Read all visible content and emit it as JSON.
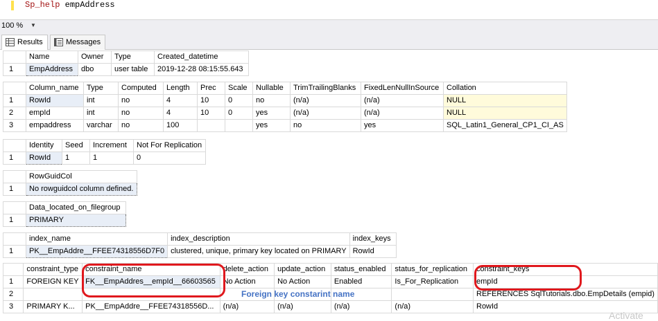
{
  "editor": {
    "keyword": "Sp_help",
    "object": "empAddress"
  },
  "zoom": {
    "value": "100 %"
  },
  "tabs": [
    {
      "label": "Results",
      "icon": "grid-icon"
    },
    {
      "label": "Messages",
      "icon": "messages-icon"
    }
  ],
  "grid1": {
    "headers": [
      "Name",
      "Owner",
      "Type",
      "Created_datetime"
    ],
    "rows": [
      {
        "n": "1",
        "cells": [
          "EmpAddress",
          "dbo",
          "user table",
          "2019-12-28 08:15:55.643"
        ]
      }
    ]
  },
  "grid2": {
    "headers": [
      "Column_name",
      "Type",
      "Computed",
      "Length",
      "Prec",
      "Scale",
      "Nullable",
      "TrimTrailingBlanks",
      "FixedLenNullInSource",
      "Collation"
    ],
    "rows": [
      {
        "n": "1",
        "cells": [
          "RowId",
          "int",
          "no",
          "4",
          "10",
          "0",
          "no",
          "(n/a)",
          "(n/a)",
          "NULL"
        ]
      },
      {
        "n": "2",
        "cells": [
          "empId",
          "int",
          "no",
          "4",
          "10",
          "0",
          "yes",
          "(n/a)",
          "(n/a)",
          "NULL"
        ]
      },
      {
        "n": "3",
        "cells": [
          "empaddress",
          "varchar",
          "no",
          "100",
          "",
          "",
          "yes",
          "no",
          "yes",
          "SQL_Latin1_General_CP1_CI_AS"
        ]
      }
    ]
  },
  "grid3": {
    "headers": [
      "Identity",
      "Seed",
      "Increment",
      "Not For Replication"
    ],
    "rows": [
      {
        "n": "1",
        "cells": [
          "RowId",
          "1",
          "1",
          "0"
        ]
      }
    ]
  },
  "grid4": {
    "headers": [
      "RowGuidCol"
    ],
    "rows": [
      {
        "n": "1",
        "cells": [
          "No rowguidcol column defined."
        ]
      }
    ]
  },
  "grid5": {
    "headers": [
      "Data_located_on_filegroup"
    ],
    "rows": [
      {
        "n": "1",
        "cells": [
          "PRIMARY"
        ]
      }
    ]
  },
  "grid6": {
    "headers": [
      "index_name",
      "index_description",
      "index_keys"
    ],
    "rows": [
      {
        "n": "1",
        "cells": [
          "PK__EmpAddre__FFEE74318556D7F0",
          "clustered, unique, primary key located on PRIMARY",
          "RowId"
        ]
      }
    ]
  },
  "grid7": {
    "headers": [
      "constraint_type",
      "constraint_name",
      "delete_action",
      "update_action",
      "status_enabled",
      "status_for_replication",
      "constraint_keys"
    ],
    "rows": [
      {
        "n": "1",
        "cells": [
          "FOREIGN KEY",
          "FK__EmpAddres__empId__66603565",
          "No Action",
          "No Action",
          "Enabled",
          "Is_For_Replication",
          "empId"
        ]
      },
      {
        "n": "2",
        "cells": [
          "",
          "",
          "",
          "",
          "",
          "",
          "REFERENCES SqlTutorials.dbo.EmpDetails (empid)"
        ]
      },
      {
        "n": "3",
        "cells": [
          "PRIMARY K...",
          "PK__EmpAddre__FFEE74318556D...",
          "(n/a)",
          "(n/a)",
          "(n/a)",
          "(n/a)",
          "RowId"
        ]
      }
    ]
  },
  "annotation": {
    "text": "Foreign key constarint name",
    "color": "#4472c4"
  },
  "watermark": "Activate",
  "colors": {
    "highlight_oval": "#e0181d",
    "null_cell": "#fffbdb"
  }
}
